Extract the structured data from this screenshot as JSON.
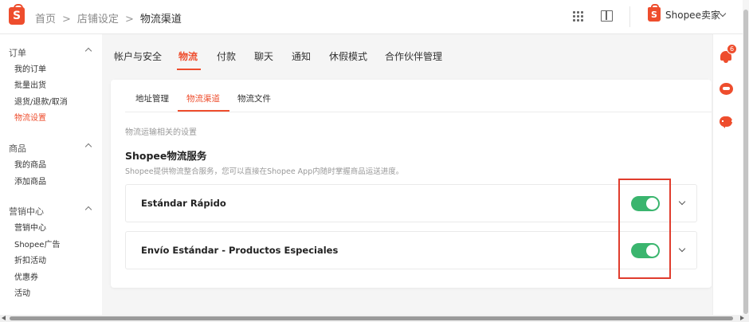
{
  "header": {
    "logo_letter": "S",
    "breadcrumb": [
      "首页",
      "店铺设定",
      "物流渠道"
    ],
    "breadcrumb_separator": ">",
    "seller_logo_letter": "S",
    "seller_name": "Shopee卖家",
    "icons": [
      "grid-icon",
      "book-icon",
      "chevron-down-icon"
    ]
  },
  "sidebar": {
    "sections": [
      {
        "title": "订单",
        "items": [
          "我的订单",
          "批量出货",
          "退货/退款/取消",
          "物流设置"
        ]
      },
      {
        "title": "商品",
        "items": [
          "我的商品",
          "添加商品"
        ]
      },
      {
        "title": "营销中心",
        "items": [
          "营销中心",
          "Shopee广告",
          "折扣活动",
          "优惠券",
          "活动"
        ]
      }
    ],
    "active_item": "物流设置"
  },
  "main_tabs": {
    "items": [
      "帐户与安全",
      "物流",
      "付款",
      "聊天",
      "通知",
      "休假模式",
      "合作伙伴管理"
    ],
    "active": "物流"
  },
  "sub_tabs": {
    "items": [
      "地址管理",
      "物流渠道",
      "物流文件"
    ],
    "active": "物流渠道"
  },
  "content": {
    "section_label": "物流运输相关的设置",
    "section_title": "Shopee物流服务",
    "section_desc": "Shopee提供物流整合服务，您可以直接在Shopee App内随时掌握商品运送进度。",
    "carriers": [
      {
        "name": "Estándar Rápido",
        "enabled": true
      },
      {
        "name": "Envío Estándar - Productos Especiales",
        "enabled": true
      }
    ]
  },
  "right_rail": {
    "notification_count": "6",
    "icons": [
      "bell-icon",
      "robot-assistant-icon",
      "chat-icon"
    ]
  },
  "colors": {
    "brand": "#ee4d2d",
    "toggle_on": "#3ab56e",
    "highlight_box": "#e03c2d"
  }
}
